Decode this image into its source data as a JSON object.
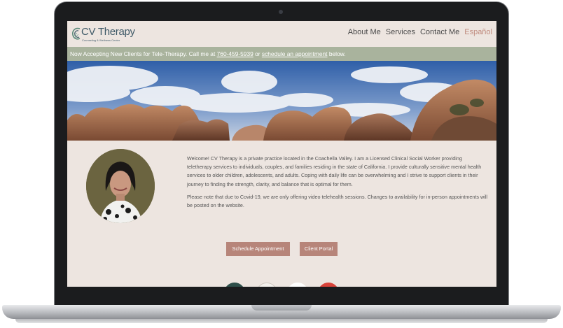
{
  "site": {
    "logo": {
      "name": "CV Therapy",
      "tagline": "Counseling & Wellness Center"
    },
    "nav": [
      {
        "label": "About Me"
      },
      {
        "label": "Services"
      },
      {
        "label": "Contact Me"
      },
      {
        "label": "Español",
        "accent": true
      }
    ],
    "banner": {
      "prefix": "Now Accepting New Clients for Tele-Therapy. Call me at",
      "phone": "760-459-5939",
      "middle": "or",
      "link": "schedule an appointment",
      "suffix": "below."
    },
    "intro": [
      "Welcome! CV Therapy is a private practice located in the Coachella Valley. I am a Licensed Clinical Social Worker providing teletherapy services to individuals, couples, and families residing in the state of California. I provide culturally sensitive mental health services to older children, adolescents, and adults. Coping with daily life can be overwhelming and I strive to support clients in their journey to finding the strength, clarity, and balance that is optimal for them.",
      "Please note that due to Covid-19, we are only offering video telehealth sessions. Changes to availability for in-person appointments will be posted on the website."
    ],
    "buttons": {
      "schedule": "Schedule Appointment",
      "portal": "Client Portal"
    }
  },
  "colors": {
    "page_bg": "#ede5e0",
    "banner_bg": "#a9b39d",
    "button_bg": "#b7857a",
    "accent_text": "#c08b7e",
    "logo_text": "#3f5a68"
  },
  "icons": [
    "logo-mark-icon",
    "hero-landscape-image",
    "therapist-portrait-image",
    "badge-icon"
  ]
}
